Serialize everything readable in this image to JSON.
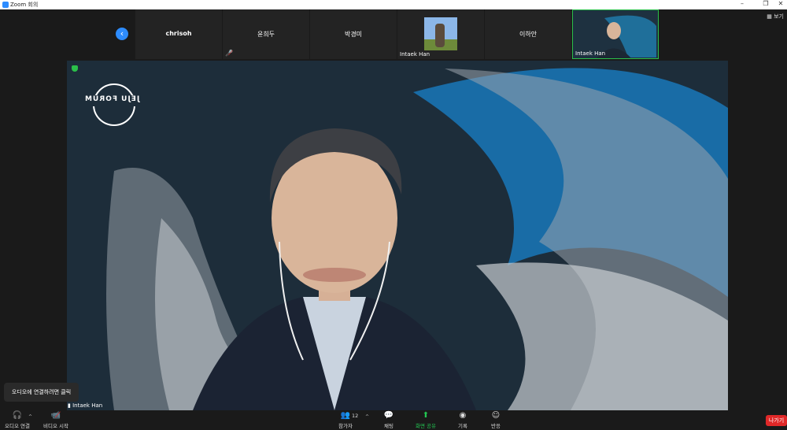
{
  "window": {
    "title": "Zoom 회의"
  },
  "top_right": {
    "view_label": "보기"
  },
  "gallery": {
    "participants": [
      {
        "name": "chrisoh"
      },
      {
        "name": "윤희두"
      },
      {
        "name": "박경미"
      },
      {
        "name": "Intaek Han",
        "kind": "photo"
      },
      {
        "name": "이하안"
      },
      {
        "name": "Intaek Han",
        "kind": "video"
      }
    ]
  },
  "main_video": {
    "speaker_name": "Intaek Han",
    "logo_text": "JEJU FORUM"
  },
  "tooltip": "오디오에 연결하려면 클릭",
  "toolbar": {
    "audio": "오디오 연결",
    "video": "비디오 시작",
    "participants": "참가자",
    "participant_count": "12",
    "chat": "채팅",
    "share": "화면 공유",
    "record": "기록",
    "reactions": "반응",
    "leave": "나가기"
  },
  "colors": {
    "accent": "#2d8cff",
    "leave": "#e02828",
    "share": "#23c552"
  }
}
